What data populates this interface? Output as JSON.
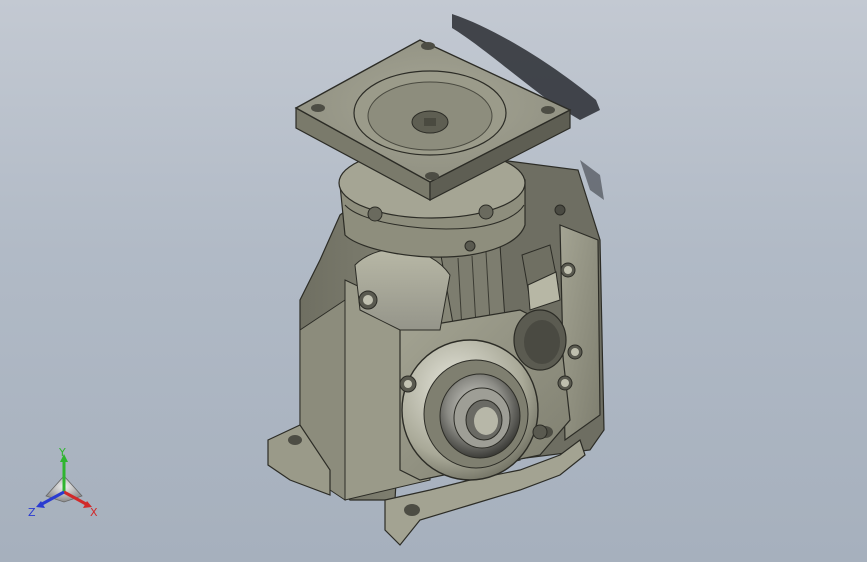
{
  "viewport": {
    "background_top": "#c3c9d2",
    "background_bottom": "#a6b0bd",
    "model_color": "#8d8d7c"
  },
  "model": {
    "name": "gear reducer",
    "parts": [
      "mounting-flange",
      "adapter-collar",
      "gearbox-housing",
      "output-bearing",
      "side-cover",
      "mounting-feet"
    ]
  },
  "triad": {
    "x_label": "X",
    "y_label": "Y",
    "z_label": "Z",
    "x_color": "#d12a2a",
    "y_color": "#2fb52f",
    "z_color": "#2a3bd1"
  }
}
